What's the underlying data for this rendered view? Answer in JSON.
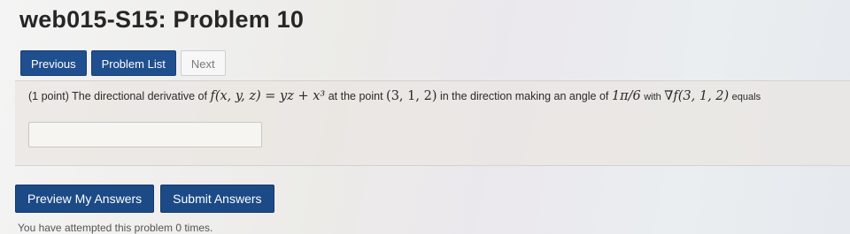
{
  "title": "web015-S15: Problem 10",
  "nav": {
    "previous": "Previous",
    "problem_list": "Problem List",
    "next": "Next"
  },
  "problem": {
    "points": "(1 point)",
    "intro": "The directional derivative of",
    "function": "f(x, y, z) = yz + x³",
    "at_the_point": "at the point",
    "point": "(3, 1, 2)",
    "direction_text": "in the direction making an angle of",
    "angle": "1π/6",
    "with": "with",
    "gradient": "∇f(3, 1, 2)",
    "equals": "equals"
  },
  "answer": {
    "value": "",
    "placeholder": ""
  },
  "actions": {
    "preview": "Preview My Answers",
    "submit": "Submit Answers"
  },
  "footer": {
    "attempts": "You have attempted this problem 0 times."
  }
}
